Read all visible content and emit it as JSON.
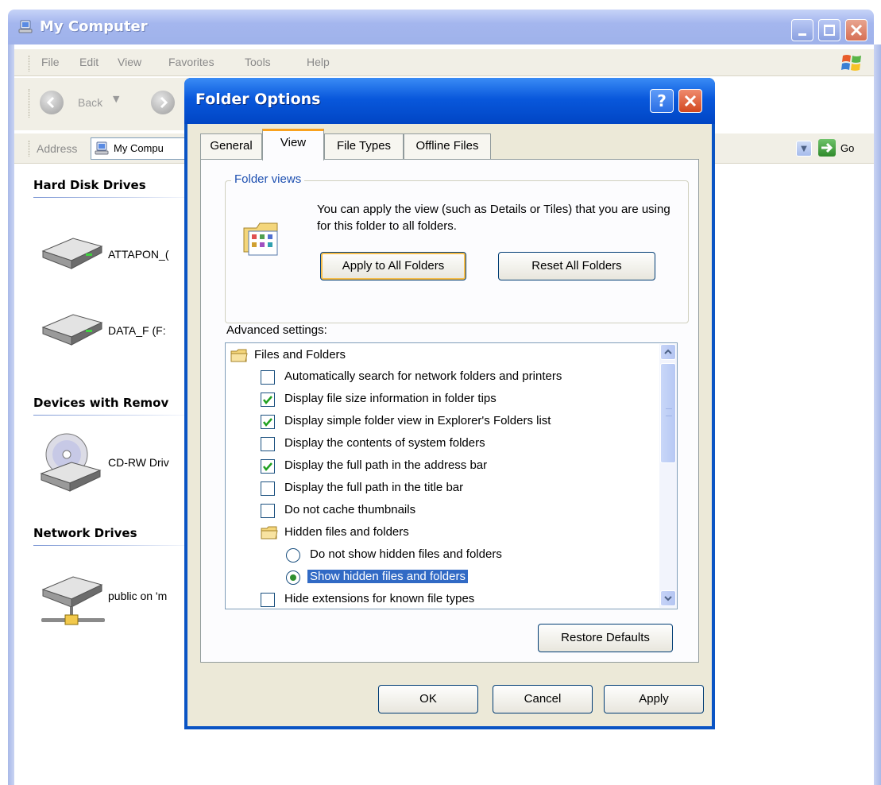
{
  "explorer": {
    "title": "My Computer",
    "menu": [
      "File",
      "Edit",
      "View",
      "Favorites",
      "Tools",
      "Help"
    ],
    "toolbar": {
      "back_label": "Back",
      "back_dropdown": "▼"
    },
    "address": {
      "label": "Address",
      "value": "My Compu",
      "go_label": "Go",
      "dropdown": "▼"
    },
    "groups": [
      {
        "header": "Hard Disk Drives"
      },
      {
        "header": "Devices with Remov"
      },
      {
        "header": "Network Drives"
      }
    ],
    "drives": [
      {
        "label": "ATTAPON_(",
        "icon": "hard-drive-icon"
      },
      {
        "label": "DATA_F (F:",
        "icon": "hard-drive-icon"
      },
      {
        "label": "CD-RW Driv",
        "icon": "cd-drive-icon"
      },
      {
        "label": "public on 'm",
        "icon": "network-drive-icon"
      }
    ]
  },
  "dialog": {
    "title": "Folder Options",
    "help_label": "?",
    "tabs": [
      {
        "label": "General",
        "active": false
      },
      {
        "label": "View",
        "active": true
      },
      {
        "label": "File Types",
        "active": false
      },
      {
        "label": "Offline Files",
        "active": false
      }
    ],
    "folder_views": {
      "legend": "Folder views",
      "description": "You can apply the view (such as Details or Tiles) that you are using for this folder to all folders.",
      "apply_all_label": "Apply to All Folders",
      "reset_all_label": "Reset All Folders"
    },
    "advanced": {
      "label": "Advanced settings:",
      "items": [
        {
          "type": "folder",
          "label": "Files and Folders"
        },
        {
          "type": "checkbox",
          "checked": false,
          "label": "Automatically search for network folders and printers"
        },
        {
          "type": "checkbox",
          "checked": true,
          "label": "Display file size information in folder tips"
        },
        {
          "type": "checkbox",
          "checked": true,
          "label": "Display simple folder view in Explorer's Folders list"
        },
        {
          "type": "checkbox",
          "checked": false,
          "label": "Display the contents of system folders"
        },
        {
          "type": "checkbox",
          "checked": true,
          "label": "Display the full path in the address bar"
        },
        {
          "type": "checkbox",
          "checked": false,
          "label": "Display the full path in the title bar"
        },
        {
          "type": "checkbox",
          "checked": false,
          "label": "Do not cache thumbnails"
        },
        {
          "type": "folder",
          "label": "Hidden files and folders"
        },
        {
          "type": "radio",
          "checked": false,
          "label": "Do not show hidden files and folders"
        },
        {
          "type": "radio",
          "checked": true,
          "selected": true,
          "label": "Show hidden files and folders"
        },
        {
          "type": "checkbox",
          "checked": false,
          "label": "Hide extensions for known file types"
        }
      ]
    },
    "restore_defaults_label": "Restore Defaults",
    "ok_label": "OK",
    "cancel_label": "Cancel",
    "apply_label": "Apply"
  },
  "colors": {
    "dialog_titlebar": "#0958dc",
    "selection": "#316ac5",
    "tab_highlight": "#f9a21e",
    "dialog_body": "#ece9d8"
  }
}
